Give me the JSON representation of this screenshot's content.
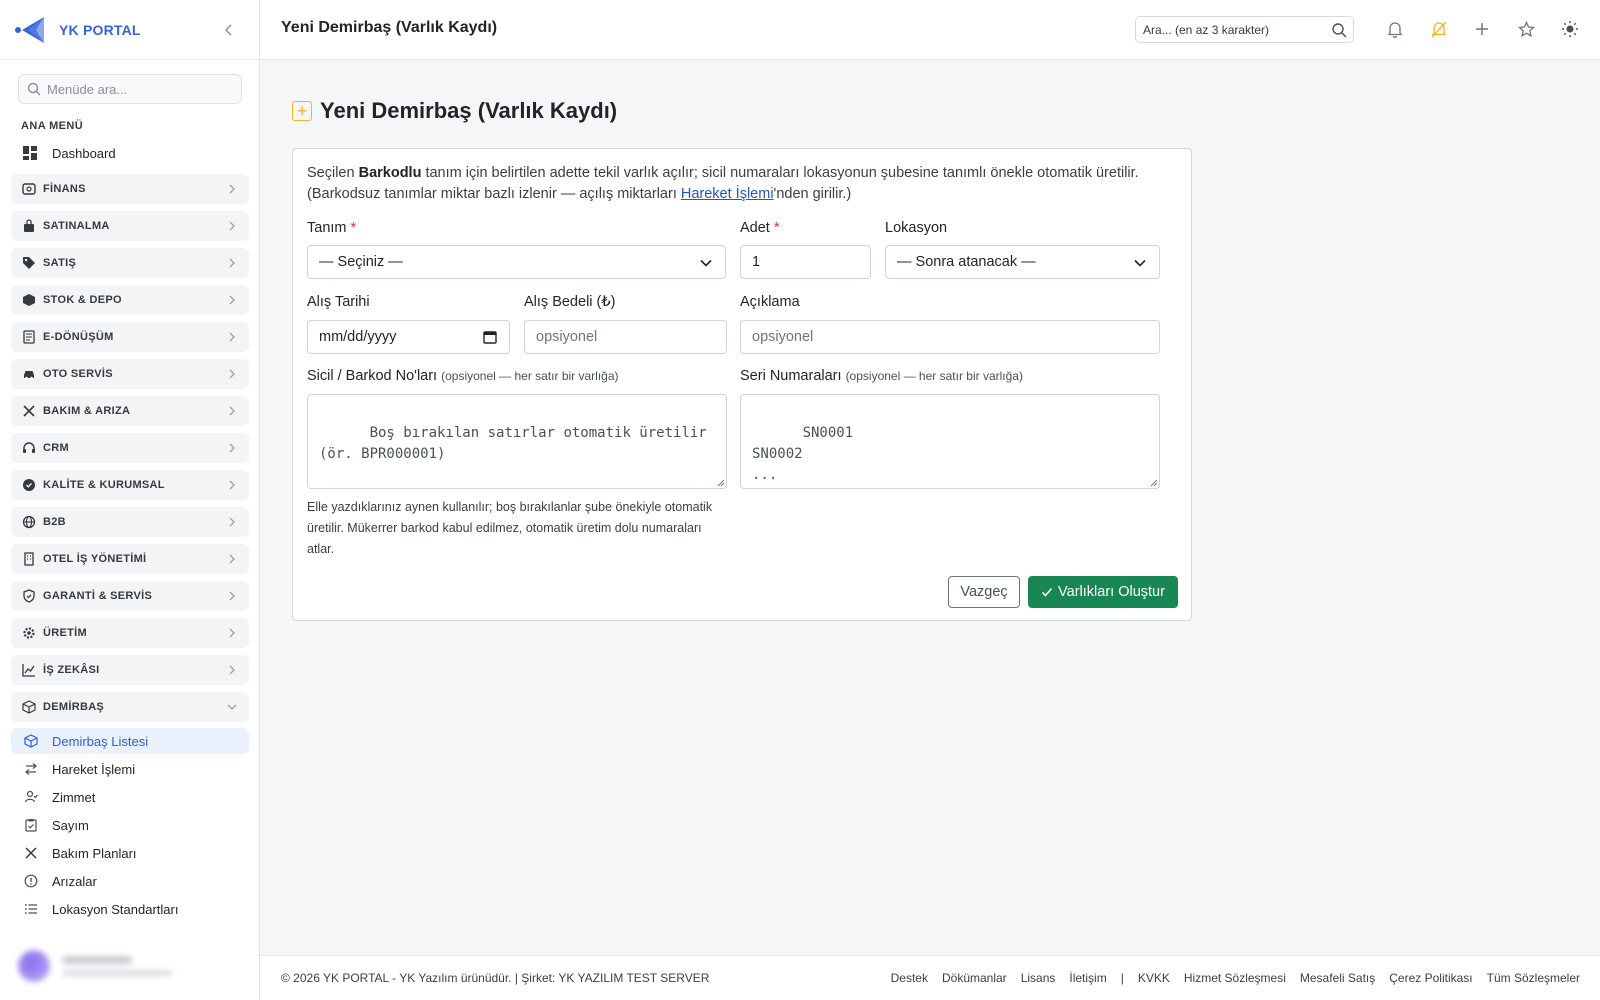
{
  "brand": {
    "name": "YK PORTAL"
  },
  "sidebar": {
    "search_placeholder": "Menüde ara...",
    "section": "ANA MENÜ",
    "dashboard": "Dashboard",
    "categories": [
      "FİNANS",
      "SATINALMA",
      "SATIŞ",
      "STOK & DEPO",
      "E-DÖNÜŞÜM",
      "OTO SERVİS",
      "BAKIM & ARIZA",
      "CRM",
      "KALİTE & KURUMSAL",
      "B2B",
      "OTEL İŞ YÖNETİMİ",
      "GARANTİ & SERVİS",
      "ÜRETİM",
      "İŞ ZEKÂSI",
      "DEMİRBAŞ"
    ],
    "sub_items": [
      "Demirbaş Listesi",
      "Hareket İşlemi",
      "Zimmet",
      "Sayım",
      "Bakım Planları",
      "Arızalar",
      "Lokasyon Standartları"
    ],
    "active_sub": "Demirbaş Listesi"
  },
  "topbar": {
    "title": "Yeni Demirbaş (Varlık Kaydı)",
    "search_placeholder": "Ara... (en az 3 karakter)"
  },
  "form": {
    "heading": "Yeni Demirbaş (Varlık Kaydı)",
    "intro_1": "Seçilen ",
    "intro_bold": "Barkodlu",
    "intro_2": " tanım için belirtilen adette tekil varlık açılır; sicil numaraları lokasyonun şubesine tanımlı önekle otomatik üretilir. (Barkodsuz tanımlar miktar bazlı izlenir — açılış miktarları ",
    "intro_link": "Hareket İşlemi",
    "intro_3": "'nden girilir.)",
    "tanim_label": "Tanım",
    "tanim_value": "— Seçiniz —",
    "adet_label": "Adet",
    "adet_value": "1",
    "lokasyon_label": "Lokasyon",
    "lokasyon_value": "— Sonra atanacak —",
    "alis_tarihi_label": "Alış Tarihi",
    "alis_tarihi_value": "mm/dd/yyyy",
    "alis_bedeli_label": "Alış Bedeli (₺)",
    "alis_bedeli_placeholder": "opsiyonel",
    "aciklama_label": "Açıklama",
    "aciklama_placeholder": "opsiyonel",
    "sicil_label": "Sicil / Barkod No'ları",
    "sicil_hint": "(opsiyonel — her satır bir varlığa)",
    "sicil_placeholder": "Boş bırakılan satırlar otomatik üretilir (ör. BPR000001)",
    "seri_label": "Seri Numaraları",
    "seri_hint": "(opsiyonel — her satır bir varlığa)",
    "seri_placeholder": "SN0001\nSN0002\n...",
    "help": "Elle yazdıklarınız aynen kullanılır; boş bırakılanlar şube önekiyle otomatik üretilir. Mükerrer barkod kabul edilmez, otomatik üretim dolu numaraları atlar.",
    "cancel": "Vazgeç",
    "submit": "Varlıkları Oluştur"
  },
  "footer": {
    "copyright": "© 2026 YK PORTAL - YK Yazılım ürünüdür. | Şirket: YK YAZILIM TEST SERVER",
    "links_a": [
      "Destek",
      "Dökümanlar",
      "Lisans",
      "İletişim"
    ],
    "separator": "|",
    "links_b": [
      "KVKK",
      "Hizmet Sözleşmesi",
      "Mesafeli Satış",
      "Çerez Politikası",
      "Tüm Sözleşmeler"
    ]
  },
  "colors": {
    "brand": "#3763d6",
    "accent_warn": "#f2b51c",
    "submit": "#198754",
    "required": "#dc3545",
    "link": "#2255c4"
  }
}
